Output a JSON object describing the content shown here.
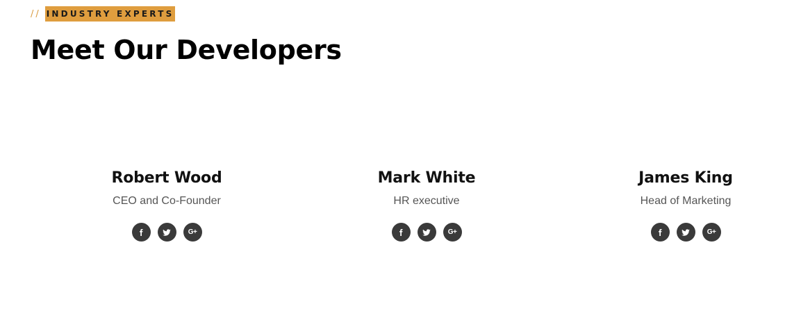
{
  "section": {
    "eyebrow_slashes": "//",
    "eyebrow": "INDUSTRY EXPERTS",
    "title": "Meet Our Developers"
  },
  "team": [
    {
      "name": "Robert Wood",
      "role": "CEO and Co-Founder",
      "socials": [
        "facebook-icon",
        "twitter-icon",
        "google-plus-icon"
      ]
    },
    {
      "name": "Mark White",
      "role": "HR executive",
      "socials": [
        "facebook-icon",
        "twitter-icon",
        "google-plus-icon"
      ]
    },
    {
      "name": "James King",
      "role": "Head of Marketing",
      "socials": [
        "facebook-icon",
        "twitter-icon",
        "google-plus-icon"
      ]
    }
  ],
  "icons": {
    "gplus_glyph": "G+"
  },
  "colors": {
    "accent": "#df9d3e",
    "social_bg": "#3a3a3a",
    "role_text": "#555555"
  }
}
